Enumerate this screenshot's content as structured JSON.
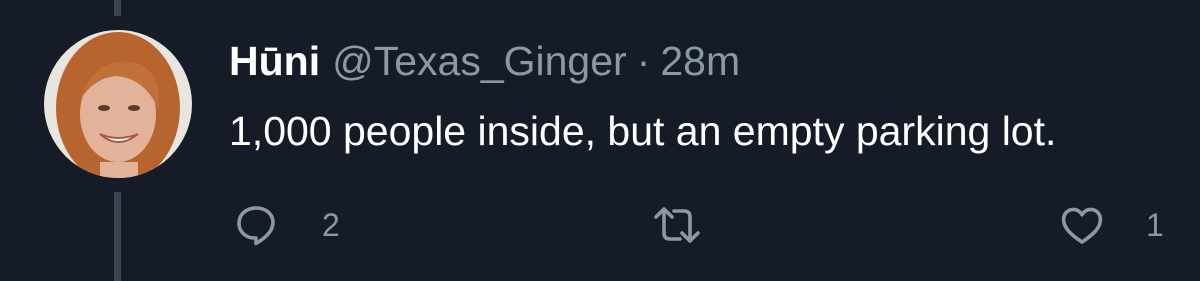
{
  "tweet": {
    "author_name": "Hūni",
    "handle": "@Texas_Ginger",
    "separator": "·",
    "time": "28m",
    "text": "1,000 people inside, but an empty parking lot."
  },
  "actions": {
    "reply": {
      "icon": "reply-icon",
      "count": "2"
    },
    "retweet": {
      "icon": "retweet-icon",
      "count": ""
    },
    "like": {
      "icon": "heart-icon",
      "count": "1"
    }
  },
  "colors": {
    "background": "#151c28",
    "primary_text": "#ffffff",
    "secondary_text": "#8b98a5",
    "thread_line": "#3a4350"
  }
}
